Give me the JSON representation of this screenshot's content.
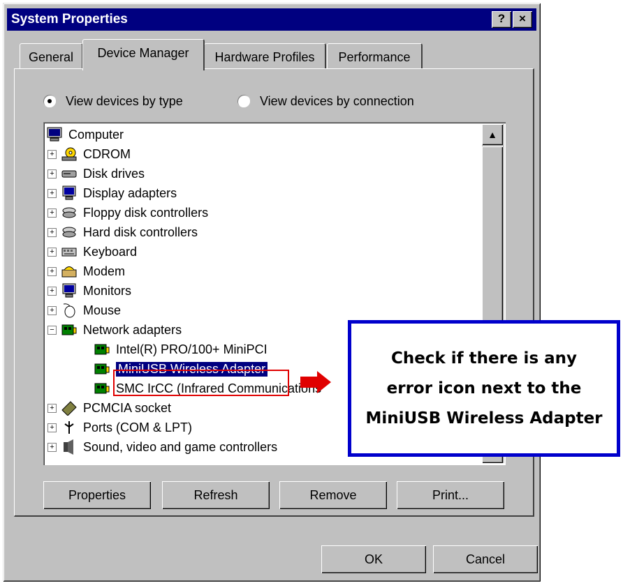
{
  "window": {
    "title": "System Properties",
    "help_label": "?",
    "close_label": "×"
  },
  "tabs": [
    {
      "label": "General"
    },
    {
      "label": "Device Manager"
    },
    {
      "label": "Hardware Profiles"
    },
    {
      "label": "Performance"
    }
  ],
  "view": {
    "by_type": "View devices by type",
    "by_connection": "View devices by connection"
  },
  "tree": {
    "root": "Computer",
    "items": [
      {
        "label": "CDROM",
        "icon": "cdrom-icon"
      },
      {
        "label": "Disk drives",
        "icon": "disk-drive-icon"
      },
      {
        "label": "Display adapters",
        "icon": "display-adapter-icon"
      },
      {
        "label": "Floppy disk controllers",
        "icon": "floppy-controller-icon"
      },
      {
        "label": "Hard disk controllers",
        "icon": "hard-disk-controller-icon"
      },
      {
        "label": "Keyboard",
        "icon": "keyboard-icon"
      },
      {
        "label": "Modem",
        "icon": "modem-icon"
      },
      {
        "label": "Monitors",
        "icon": "monitor-icon"
      },
      {
        "label": "Mouse",
        "icon": "mouse-icon"
      },
      {
        "label": "Network adapters",
        "icon": "network-adapter-icon"
      },
      {
        "label": "Intel(R) PRO/100+ MiniPCI",
        "icon": "network-card-icon"
      },
      {
        "label": "MiniUSB Wireless Adapter",
        "icon": "network-card-icon",
        "selected": true
      },
      {
        "label": "SMC IrCC (Infrared Communications",
        "icon": "network-card-icon"
      },
      {
        "label": "PCMCIA socket",
        "icon": "pcmcia-icon"
      },
      {
        "label": "Ports (COM & LPT)",
        "icon": "port-icon"
      },
      {
        "label": "Sound, video and game controllers",
        "icon": "sound-icon"
      }
    ]
  },
  "buttons": {
    "properties": "Properties",
    "refresh": "Refresh",
    "remove": "Remove",
    "print": "Print...",
    "ok": "OK",
    "cancel": "Cancel"
  },
  "annotation": {
    "line1": "Check if there is any",
    "line2": "error icon next to the",
    "line3": "MiniUSB Wireless Adapter"
  },
  "colors": {
    "titlebar": "#000080",
    "selection": "#000080",
    "callout_border": "#0000cc",
    "arrow": "#e00000"
  }
}
